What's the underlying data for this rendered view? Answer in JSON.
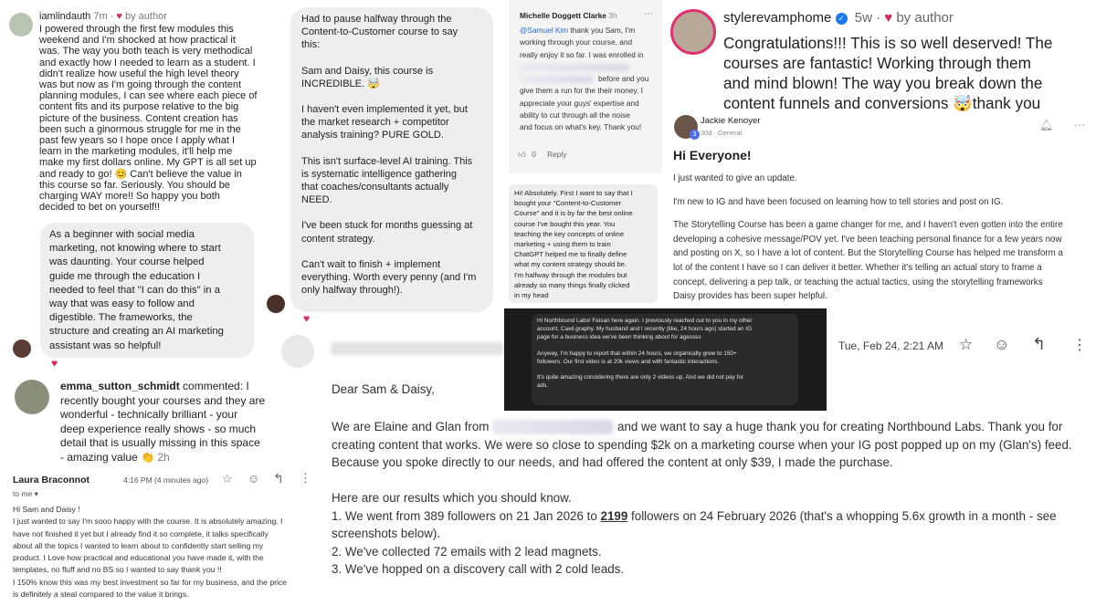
{
  "c1": {
    "username": "iamlindauth",
    "time": "7m",
    "by_author": "by author",
    "lines": [
      "I powered through the first few modules this",
      "weekend and I'm shocked at how practical it",
      "was. The way you both teach is very methodical",
      "and exactly how I needed to learn as a student. I",
      "didn't realize how useful the high level theory",
      "was but now as I'm going through the content",
      "planning modules, I can see where each piece of",
      "content fits and its purpose relative to the big",
      "picture of the business. Content creation has",
      "been such a ginormous struggle for me in the",
      "past few years so I hope once I apply what I",
      "learn in the marketing modules, it'll help me",
      "make my first dollars online. My GPT is all set up",
      "and ready to go! 😊 Can't believe the value in",
      "this course so far. Seriously. You should be",
      "charging WAY more!! So happy you both",
      "decided to bet on yourself!!"
    ]
  },
  "c2": {
    "lines": [
      "As a beginner with social media",
      "marketing, not knowing where to start",
      "was daunting. Your course helped",
      "guide me through the education I",
      "needed to feel that \"I can do this\" in a",
      "way that was easy to follow and",
      "digestible. The frameworks, the",
      "structure and creating an AI marketing",
      "assistant was so helpful!"
    ]
  },
  "c3": {
    "username": "emma_sutton_schmidt",
    "first_line": " commented: I",
    "lines": [
      "recently bought your courses and they are",
      "wonderful - technically brilliant - your",
      "deep experience really shows - so much",
      "detail that is usually missing in this space"
    ],
    "last_line": "- amazing value 👏",
    "time": "2h"
  },
  "c4": {
    "sender": "Laura Braconnot",
    "time": "4:16 PM (4 minutes ago)",
    "to": "to me",
    "greeting": "Hi Sam and Daisy !",
    "lines": [
      "I just wanted to say I'm sooo happy with the course. It is absolutely amazing. I",
      "have not finished it yet but I already find it so complete, it talks specifically",
      "about all the topics I wanted to learn about to confidently start selling my",
      "product. I Love how practical and educational you have made it, with the",
      "templates, no fluff and no BS so I wanted to say thank you !!",
      "I 150% know this was my best investment so far for my business, and the price",
      "is definitely a steal compared to the value it brings."
    ]
  },
  "c5": {
    "paragraphs": [
      [
        "Had to pause halfway through the",
        "Content-to-Customer course to say",
        "this:"
      ],
      [
        "Sam and Daisy, this course is",
        "INCREDIBLE. 🤯"
      ],
      [
        "I haven't even implemented it yet, but",
        "the market research + competitor",
        "analysis training? PURE GOLD."
      ],
      [
        "This isn't surface-level AI training. This",
        "is systematic intelligence gathering",
        "that coaches/consultants actually",
        "NEED."
      ],
      [
        "I've been stuck for months guessing at",
        "content strategy."
      ],
      [
        "Can't wait to finish + implement",
        "everything. Worth every penny (and I'm",
        "only halfway through!)."
      ]
    ]
  },
  "c6": {
    "name": "Michelle Doggett Clarke",
    "time": "3h",
    "mention": "@Samuel Kim",
    "first_line_rest": " thank you Sam, I'm",
    "lines_a": [
      "working through your course, and",
      "really enjoy it so far. I was enrolled in"
    ],
    "line_b_rest": "before and you",
    "lines_c": [
      "give them a run for the their money. I",
      "appreciate your guys' expertise and",
      "ability to cut through all the noise",
      "and focus on what's key. Thank you!"
    ],
    "like_count": "0",
    "reply": "Reply"
  },
  "c7": {
    "lines": [
      "Hi! Absolutely. First I want to say that I",
      "bought your \"Content-to-Customer",
      "Course\" and it is by far the best online",
      "course I've bought this year. You",
      "teaching the key concepts of online",
      "marketing + using them to train",
      "ChatGPT helped me to finally define",
      "what my content strategy should be.",
      "I'm halfway through the modules but",
      "already so many things finally clicked",
      "in my head"
    ]
  },
  "c8": {
    "lines": [
      "Hi Northbound Labs! Feisan here again. I previously reached out to you in my other",
      "account, Caeli.graphy. My husband and I recently (like, 24 hours ago) started an IG",
      "page for a business idea we've been thinking about for agessss",
      "",
      "Anyway, I'm happy to report that within 24 hours, we organically grew to 150+",
      "followers. Our first video is at 20k views and with fantastic interactions.",
      "",
      "It's quite amazing considering there are only 2 videos up.  And we did not pay for",
      "ads."
    ]
  },
  "c9": {
    "time": "Tue, Feb 24, 2:21 AM",
    "greeting": "Dear Sam & Daisy,",
    "intro_start": "We are Elaine and Glan from",
    "intro_end": "and we want to say a huge thank you for creating Northbound Labs. Thank you for",
    "lines": [
      "creating content that works. We were so close to spending $2k on a marketing course when your IG post popped up on my (Glan's) feed.",
      "Because you spoke directly to our needs, and had offered the content at only $39, I made the purchase."
    ],
    "results_heading": "Here are our results which you should know.",
    "r1_start": "1. We went from 389 followers on 21 Jan 2026 to ",
    "r1_bold": "2199",
    "r1_end": " followers on 24 February 2026 (that's a whopping 5.6x growth in a month - see",
    "r1_cont": "screenshots below).",
    "r2": "2. We've collected 72 emails with 2 lead magnets.",
    "r3": "3. We've hopped on a discovery call with 2 cold leads."
  },
  "c10": {
    "username": "stylerevamphome",
    "time": "5w",
    "by_author": "by author",
    "lines": [
      "Congratulations!!! This is so well deserved! The",
      "courses are fantastic! Working through them",
      "and mind blown! The way you break down the"
    ],
    "last_start": "content funnels and conversions ",
    "last_emoji": "🤯",
    "last_end": "thank you"
  },
  "c11": {
    "name": "Jackie Kenoyer",
    "badge": "3",
    "meta": "30d · General",
    "title": "Hi Everyone!",
    "p1": "I just wanted to give an update.",
    "p2": "I'm new to IG and have been focused on learning how to tell stories and post on IG.",
    "p3": [
      "The Storytelling Course has been a game changer for me, and I haven't even gotten into the entire",
      "developing a cohesive message/POV yet. I've been teaching personal finance for a few years now",
      "and posting on X, so I have a lot of content. But the Storytelling Course has helped me transform a",
      "lot of the content I have so I can deliver it better. Whether it's telling an actual story to frame a",
      "concept, delivering a pep talk, or teaching the actual tactics, using the storytelling frameworks",
      "Daisy provides has been super helpful."
    ]
  },
  "colors": {
    "heart": "#e0245e",
    "verified": "#1877f2",
    "dark_panel": "#1b1b1b",
    "badge": "#4c6ef5"
  }
}
